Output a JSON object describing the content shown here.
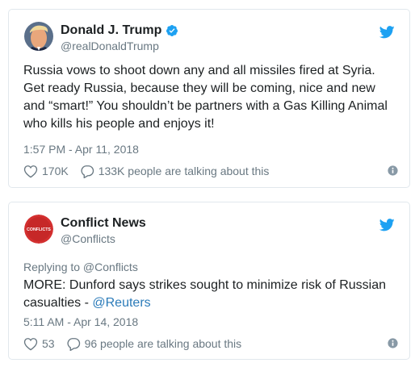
{
  "tweets": [
    {
      "name": "Donald J. Trump",
      "handle": "@realDonaldTrump",
      "text": "Russia vows to shoot down any and all missiles fired at Syria. Get ready Russia,  because they will be coming, nice and new and “smart!” You shouldn’t be partners with a Gas Killing Animal who kills his people and enjoys it!",
      "time": "1:57 PM - Apr 11, 2018",
      "likes": "170K",
      "talking": "133K people are talking about this"
    },
    {
      "name": "Conflict News",
      "handle": "@Conflicts",
      "avatar_text": "CONFLICTS",
      "reply_to": "Replying to @Conflicts",
      "text_prefix": "MORE: Dunford says strikes sought to minimize risk of Russian casualties - ",
      "text_link": "@Reuters",
      "time": "5:11 AM - Apr 14, 2018",
      "likes": "53",
      "talking": "96 people are talking about this"
    }
  ],
  "colors": {
    "twitter_blue": "#1da1f2",
    "link": "#2b7bb9",
    "secondary_text": "#697882",
    "border": "#e1e8ed"
  },
  "icons": [
    "twitter-bird-icon",
    "verified-badge-icon",
    "heart-icon",
    "comment-icon",
    "info-icon"
  ]
}
